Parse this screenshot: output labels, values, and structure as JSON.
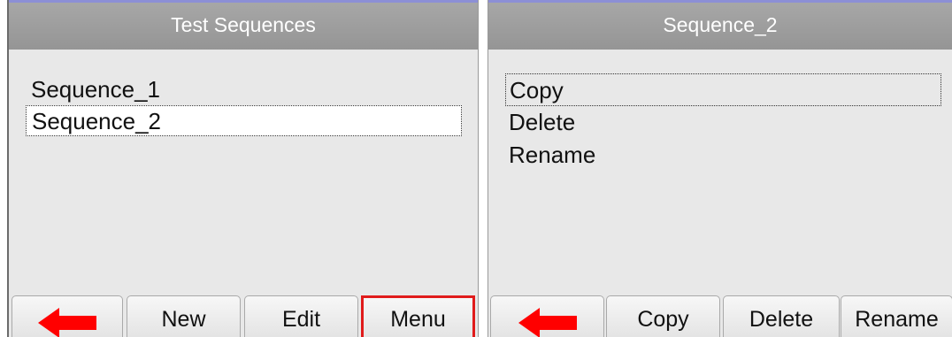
{
  "left_panel": {
    "title": "Test Sequences",
    "items": [
      {
        "label": "Sequence_1",
        "selected": false
      },
      {
        "label": "Sequence_2",
        "selected": true
      }
    ],
    "buttons": {
      "back_icon": "arrow-left-icon",
      "new": "New",
      "edit": "Edit",
      "menu": "Menu"
    },
    "highlighted_button": "menu"
  },
  "right_panel": {
    "title": "Sequence_2",
    "items": [
      {
        "label": "Copy",
        "selected": true
      },
      {
        "label": "Delete",
        "selected": false
      },
      {
        "label": "Rename",
        "selected": false
      }
    ],
    "buttons": {
      "back_icon": "arrow-left-icon",
      "copy": "Copy",
      "delete": "Delete",
      "rename": "Rename"
    }
  },
  "colors": {
    "titlebar": "#9e9e9e",
    "titlebar_accent": "#8c8fd6",
    "panel_bg": "#e8e8e8",
    "back_arrow": "#ff0000",
    "highlight_border": "#e01b1b"
  }
}
